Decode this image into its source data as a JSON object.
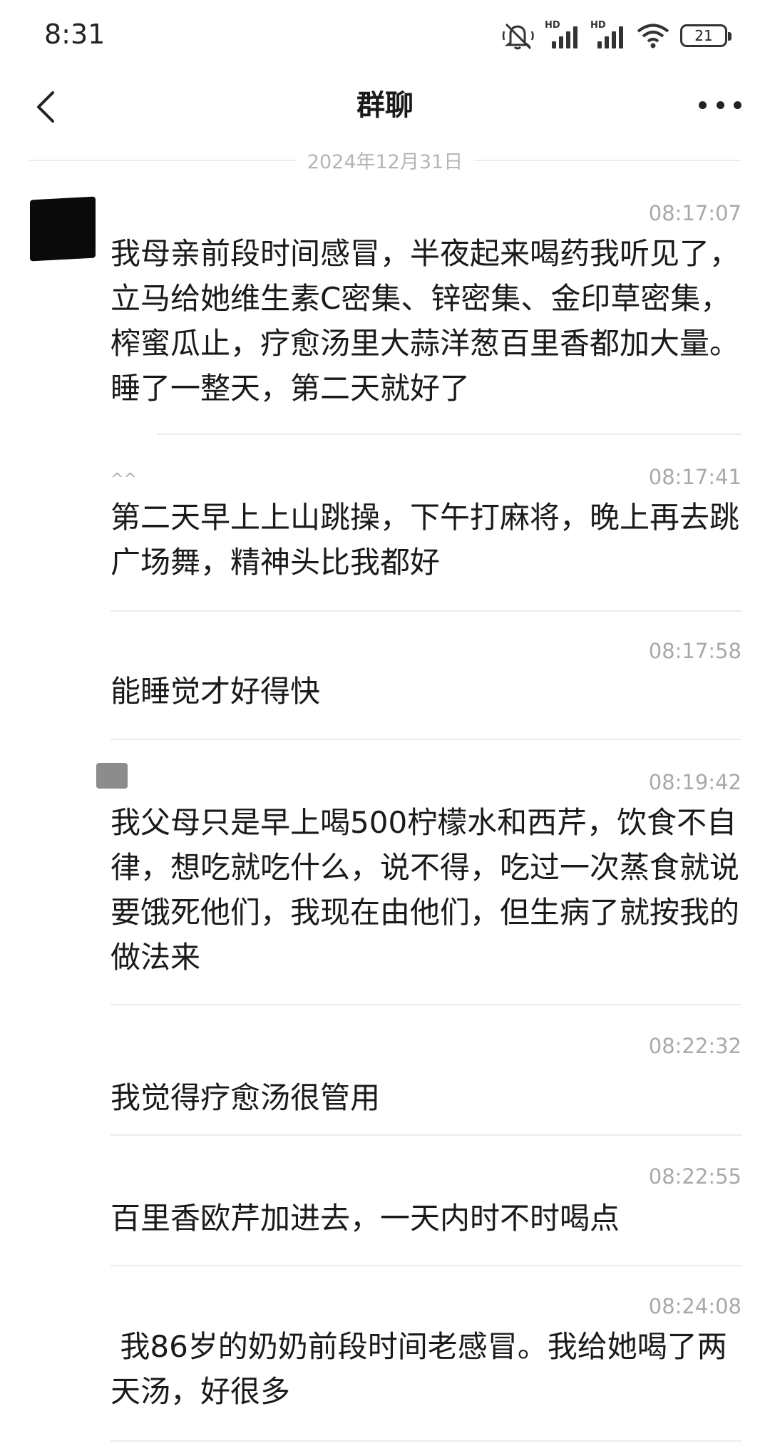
{
  "status_bar": {
    "time": "8:31",
    "hd1": "HD",
    "hd2": "HD",
    "battery": "21",
    "icons": [
      "mute-icon",
      "signal-icon",
      "signal-icon",
      "wifi-icon",
      "battery-icon"
    ]
  },
  "nav": {
    "title": "群聊",
    "back_icon": "chevron-left-icon",
    "more_icon": "more-icon"
  },
  "date_separator": "2024年12月31日",
  "messages": [
    {
      "nick": "",
      "time": "08:17:07",
      "text": "我母亲前段时间感冒，半夜起来喝药我听见了，立马给她维生素C密集、锌密集、金印草密集，榨蜜瓜止，疗愈汤里大蒜洋葱百里香都加大量。睡了一整天，第二天就好了"
    },
    {
      "nick": "^^",
      "time": "08:17:41",
      "text": "第二天早上上山跳操，下午打麻将，晚上再去跳广场舞，精神头比我都好"
    },
    {
      "nick": "",
      "time": "08:17:58",
      "text": "能睡觉才好得快"
    },
    {
      "nick": "",
      "time": "08:19:42",
      "text": "我父母只是早上喝500柠檬水和西芹，饮食不自律，想吃就吃什么，说不得，吃过一次蒸食就说要饿死他们，我现在由他们，但生病了就按我的做法来"
    },
    {
      "nick": "",
      "time": "08:22:32",
      "text": "我觉得疗愈汤很管用"
    },
    {
      "nick": "",
      "time": "08:22:55",
      "text": "百里香欧芹加进去，一天内时不时喝点"
    },
    {
      "nick": "",
      "time": "08:24:08",
      "text": " 我86岁的奶奶前段时间老感冒。我给她喝了两天汤，好很多"
    }
  ],
  "colors": {
    "text": "#1a1a1a",
    "secondary": "#a9a9a9",
    "divider": "#ececec",
    "background": "#ffffff"
  }
}
